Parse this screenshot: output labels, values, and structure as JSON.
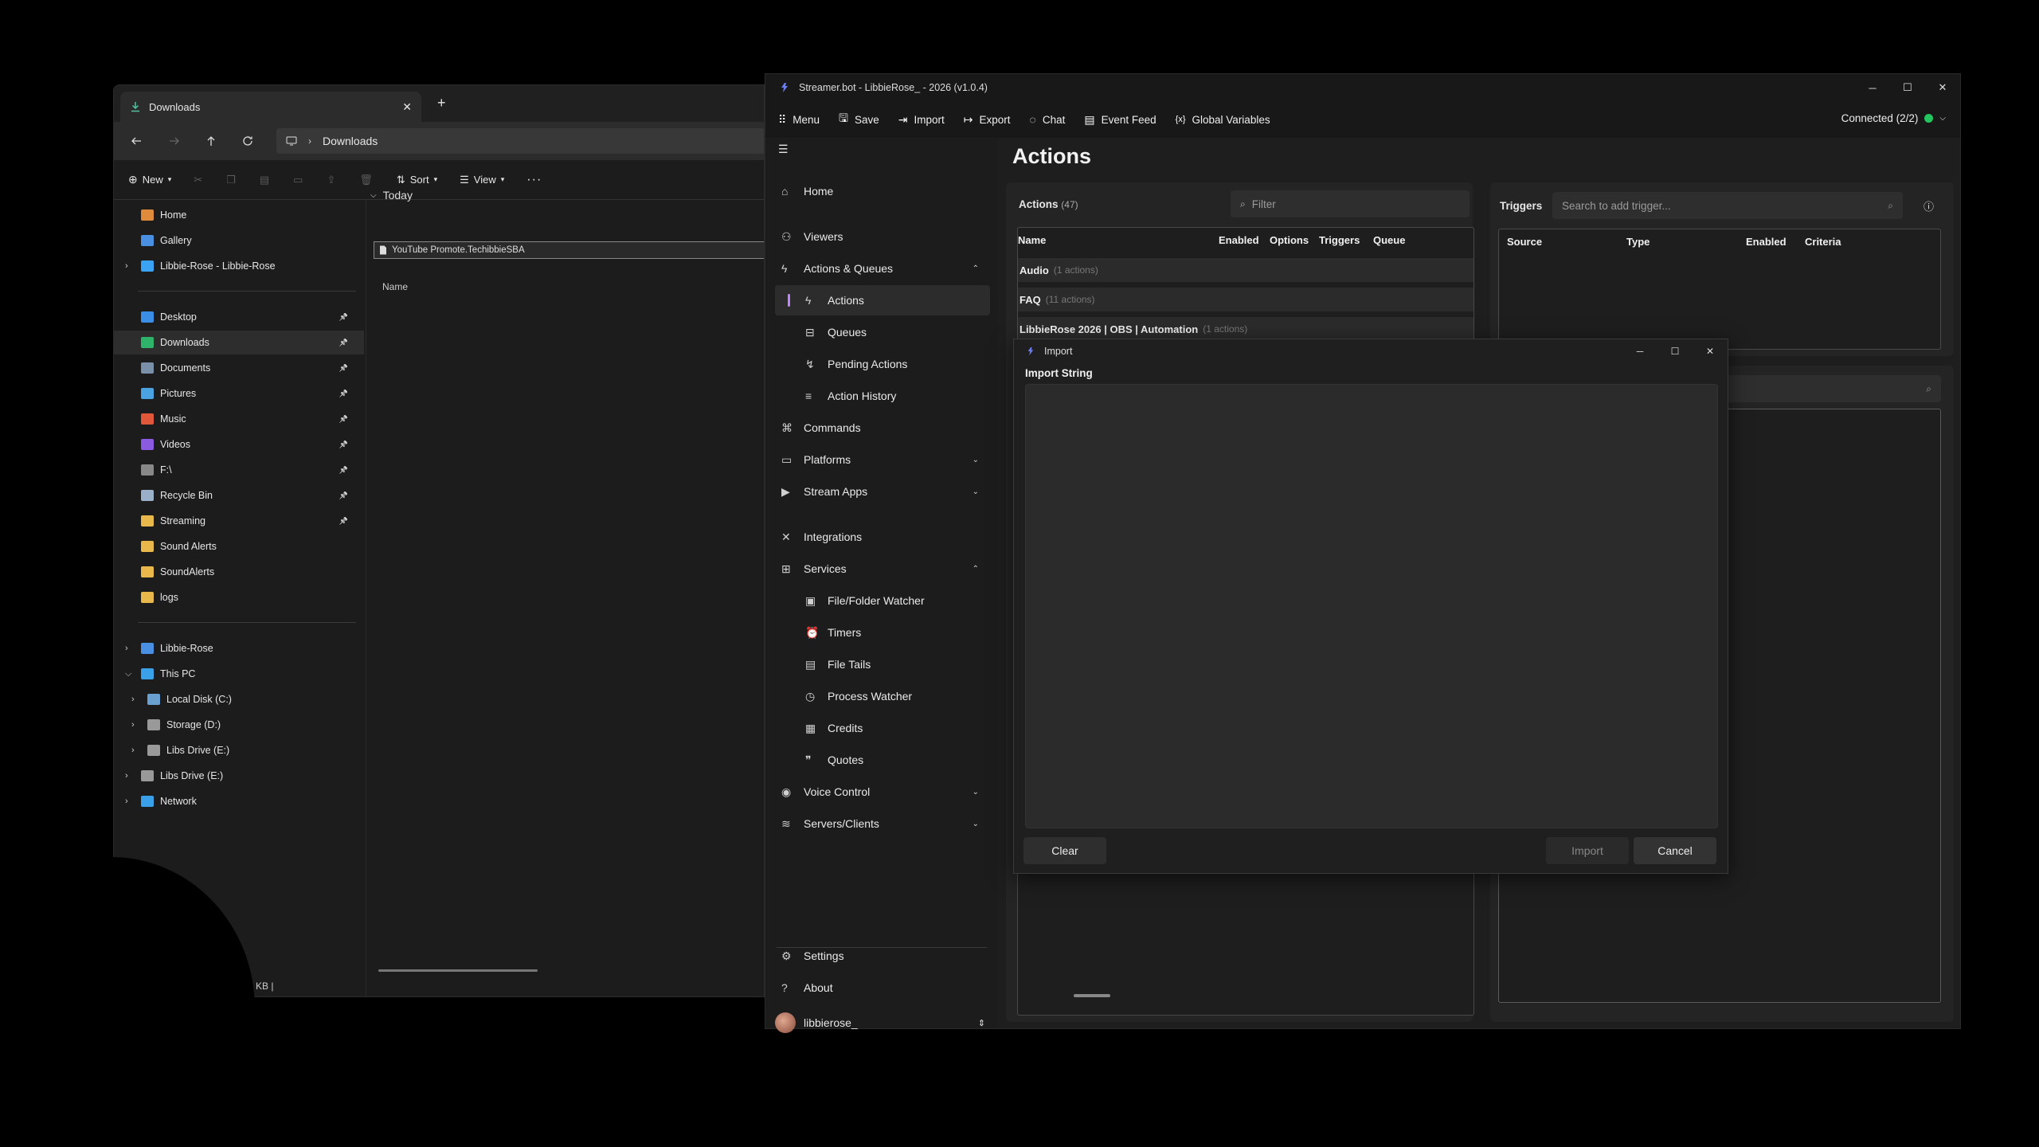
{
  "explorer": {
    "tab_title": "Downloads",
    "breadcrumb": "Downloads",
    "commands": {
      "new": "New",
      "sort": "Sort",
      "view": "View"
    },
    "nav": [
      {
        "label": "Home",
        "color": "#e08a3c",
        "pin": false,
        "chev": false,
        "indent": 0
      },
      {
        "label": "Gallery",
        "color": "#4a90e2",
        "pin": false,
        "chev": false,
        "indent": 0
      },
      {
        "label": "Libbie-Rose - Libbie-Rose",
        "color": "#3ba3f5",
        "pin": false,
        "chev": true,
        "indent": 0
      },
      {
        "label": "Desktop",
        "color": "#3a8ee6",
        "pin": true,
        "chev": false,
        "indent": 0
      },
      {
        "label": "Downloads",
        "color": "#2fb36b",
        "pin": true,
        "chev": false,
        "indent": 0
      },
      {
        "label": "Documents",
        "color": "#7a8fa8",
        "pin": true,
        "chev": false,
        "indent": 0
      },
      {
        "label": "Pictures",
        "color": "#4aa3e0",
        "pin": true,
        "chev": false,
        "indent": 0
      },
      {
        "label": "Music",
        "color": "#e0573a",
        "pin": true,
        "chev": false,
        "indent": 0
      },
      {
        "label": "Videos",
        "color": "#8a5ae0",
        "pin": true,
        "chev": false,
        "indent": 0
      },
      {
        "label": "F:\\",
        "color": "#888888",
        "pin": true,
        "chev": false,
        "indent": 0
      },
      {
        "label": "Recycle Bin",
        "color": "#9ab0c8",
        "pin": true,
        "chev": false,
        "indent": 0
      },
      {
        "label": "Streaming",
        "color": "#e8b84a",
        "pin": true,
        "chev": false,
        "indent": 0
      },
      {
        "label": "Sound Alerts",
        "color": "#e8b84a",
        "pin": false,
        "chev": false,
        "indent": 0
      },
      {
        "label": "SoundAlerts",
        "color": "#e8b84a",
        "pin": false,
        "chev": false,
        "indent": 0
      },
      {
        "label": "logs",
        "color": "#e8b84a",
        "pin": false,
        "chev": false,
        "indent": 0
      },
      {
        "label": "Libbie-Rose",
        "color": "#4a90e2",
        "pin": false,
        "chev": true,
        "indent": 0
      },
      {
        "label": "This PC",
        "color": "#3aa0e8",
        "pin": false,
        "chev": true,
        "indent": 0
      },
      {
        "label": "Local Disk (C:)",
        "color": "#6aa0d0",
        "pin": false,
        "chev": true,
        "indent": 1
      },
      {
        "label": "Storage (D:)",
        "color": "#999999",
        "pin": false,
        "chev": true,
        "indent": 1
      },
      {
        "label": "Libs Drive (E:)",
        "color": "#999999",
        "pin": false,
        "chev": true,
        "indent": 1
      },
      {
        "label": "Libs Drive (E:)",
        "color": "#999999",
        "pin": false,
        "chev": true,
        "indent": 0
      },
      {
        "label": "Network",
        "color": "#3aa0e8",
        "pin": false,
        "chev": true,
        "indent": 0
      }
    ],
    "column_name": "Name",
    "group_today": "Today",
    "file_name": "YouTube Promote.TechibbieSBA",
    "status_text": "KB  |"
  },
  "streamerbot": {
    "window_title": "Streamer.bot - LibbieRose_ - 2026 (v1.0.4)",
    "menu": [
      "Menu",
      "Save",
      "Import",
      "Export",
      "Chat",
      "Event Feed",
      "Global Variables"
    ],
    "connection": "Connected (2/2)",
    "connection_color": "#22c55e",
    "sidebar": {
      "home": "Home",
      "viewers": "Viewers",
      "actions_queues": "Actions & Queues",
      "actions": "Actions",
      "queues": "Queues",
      "pending_actions": "Pending Actions",
      "action_history": "Action History",
      "commands": "Commands",
      "platforms": "Platforms",
      "stream_apps": "Stream Apps",
      "integrations": "Integrations",
      "services": "Services",
      "file_folder_watcher": "File/Folder Watcher",
      "timers": "Timers",
      "file_tails": "File Tails",
      "process_watcher": "Process Watcher",
      "credits": "Credits",
      "quotes": "Quotes",
      "voice_control": "Voice Control",
      "servers_clients": "Servers/Clients",
      "settings": "Settings",
      "about": "About",
      "username": "libbierose_"
    },
    "page_title": "Actions",
    "actions_panel": {
      "title": "Actions",
      "count": "(47)",
      "filter_placeholder": "Filter",
      "columns": [
        "Name",
        "Enabled",
        "Options",
        "Triggers",
        "Queue"
      ],
      "groups": [
        {
          "name": "Audio",
          "count": "(1 actions)"
        },
        {
          "name": "FAQ",
          "count": "(11 actions)"
        },
        {
          "name": "LibbieRose 2026 | OBS | Automation",
          "count": "(1 actions)"
        }
      ]
    },
    "triggers_panel": {
      "title": "Triggers",
      "search_placeholder": "Search to add trigger...",
      "columns": [
        "Source",
        "Type",
        "Enabled",
        "Criteria"
      ]
    }
  },
  "import_dialog": {
    "title": "Import",
    "label": "Import String",
    "value": "",
    "clear": "Clear",
    "import": "Import",
    "cancel": "Cancel"
  },
  "colors": {
    "accent": "#c084fc",
    "background": "#181818"
  }
}
